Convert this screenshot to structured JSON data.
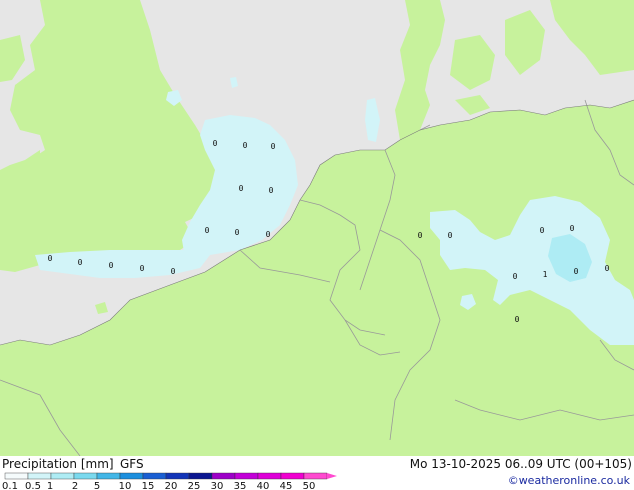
{
  "title": "Precipitation [mm]",
  "model": "GFS",
  "valid_time": "Mo 13-10-2025 06..09 UTC (00+105)",
  "credit": "©weatheronline.co.uk",
  "legend": {
    "ticks": [
      "0.1",
      "0.5",
      "1",
      "2",
      "5",
      "10",
      "15",
      "20",
      "25",
      "30",
      "35",
      "40",
      "45",
      "50"
    ],
    "colors": [
      "#f5fbfc",
      "#d2f4f8",
      "#aeecf4",
      "#7ad9ee",
      "#42b6e7",
      "#1c8fde",
      "#1a5fd3",
      "#1235b8",
      "#0b1690",
      "#9d00c8",
      "#c200d8",
      "#de00d8",
      "#f000d0",
      "#ff4ad0"
    ]
  },
  "colors": {
    "sea": "#e6e6e6",
    "land": "#c7f29c",
    "border": "#999999",
    "precip_light": "#d2f4f8",
    "precip_medium": "#aeecf4"
  },
  "precip_labels": [
    {
      "text": "0"
    },
    {
      "text": "0"
    },
    {
      "text": "0"
    },
    {
      "text": "0"
    },
    {
      "text": "0"
    },
    {
      "text": "0"
    },
    {
      "text": "0"
    },
    {
      "text": "0"
    },
    {
      "text": "0"
    },
    {
      "text": "0"
    },
    {
      "text": "0"
    },
    {
      "text": "0"
    },
    {
      "text": "0"
    },
    {
      "text": "0"
    },
    {
      "text": "0"
    },
    {
      "text": "0"
    },
    {
      "text": "0"
    },
    {
      "text": "0"
    },
    {
      "text": "1"
    },
    {
      "text": "0"
    },
    {
      "text": "0"
    },
    {
      "text": "0"
    }
  ]
}
